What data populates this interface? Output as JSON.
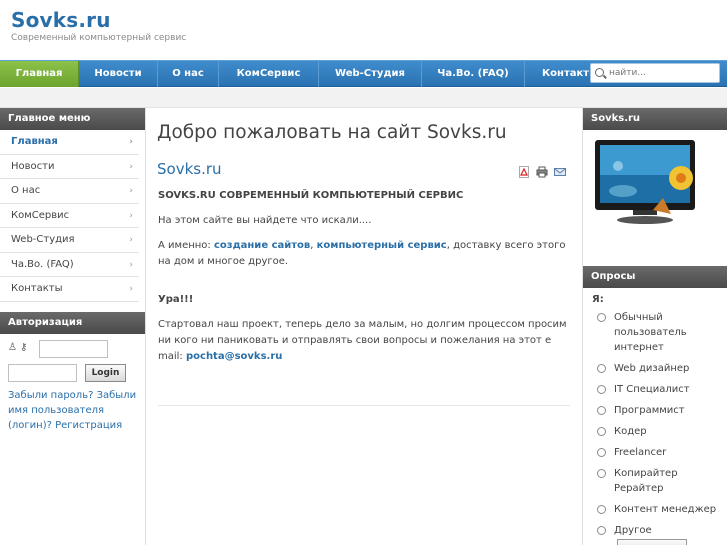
{
  "site": {
    "title": "Sovks.ru",
    "subtitle": "Современный компьютерный сервис"
  },
  "nav": {
    "items": [
      {
        "label": "Главная",
        "active": true
      },
      {
        "label": "Новости",
        "active": false
      },
      {
        "label": "О нас",
        "active": false
      },
      {
        "label": "КомСервис",
        "active": false
      },
      {
        "label": "Web-Студия",
        "active": false
      },
      {
        "label": "Ча.Во. (FAQ)",
        "active": false
      },
      {
        "label": "Контакты",
        "active": false
      }
    ],
    "search_placeholder": "найти..."
  },
  "left": {
    "menu_title": "Главное меню",
    "menu": [
      "Главная",
      "Новости",
      "О нас",
      "КомСервис",
      "Web-Студия",
      "Ча.Во. (FAQ)",
      "Контакты"
    ],
    "auth_title": "Авторизация",
    "login_button": "Login",
    "forgot_link": "Забыли пароль? Забыли имя пользователя (логин)?",
    "register_link": "Регистрация"
  },
  "main": {
    "page_title": "Добро пожаловать на сайт Sovks.ru",
    "article_title": "Sovks.ru",
    "heading": "SOVKS.RU СОВРЕМЕННЫЙ КОМПЬЮТЕРНЫЙ СЕРВИС",
    "p1": "На этом сайте вы найдете что искали....",
    "p2_prefix": "А именно: ",
    "p2_link1": "создание сайтов",
    "p2_sep": ", ",
    "p2_link2": "компьютерный сервис",
    "p2_suffix": ", доставку всего этого на дом и многое другое.",
    "hooray": "Ура!!!",
    "p3": "Стартовал наш проект, теперь дело за малым, но долгим процессом просим ни кого ни паниковать и отправлять свои вопросы и пожелания на этот е mail: ",
    "email": "pochta@sovks.ru"
  },
  "right": {
    "box1_title": "Sovks.ru",
    "polls_title": "Опросы",
    "poll_question": "Я:",
    "poll_options": [
      "Обычный пользователь интернет",
      "Web дизайнер",
      "IT Специалист",
      "Программист",
      "Кодер",
      "Freelancer",
      "Копирайтер Рерайтер",
      "Контент менеджер",
      "Другое"
    ]
  },
  "colors": {
    "brand_blue": "#2a6fa8",
    "nav_blue": "#3480c0",
    "nav_active_green": "#7bb33a",
    "box_header_gray": "#585858"
  }
}
